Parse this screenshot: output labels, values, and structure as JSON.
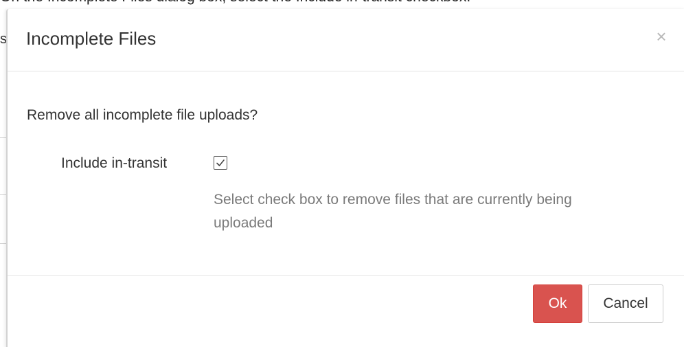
{
  "instruction": "On the Incomplete Files dialog box, select the Include in-transit checkbox.",
  "background": {
    "partial_char": "s"
  },
  "dialog": {
    "title": "Incomplete Files",
    "close_glyph": "×",
    "question": "Remove all incomplete file uploads?",
    "include_in_transit": {
      "label": "Include in-transit",
      "checked": true,
      "help": "Select check box to remove files that are currently being uploaded"
    },
    "buttons": {
      "ok_label": "Ok",
      "cancel_label": "Cancel"
    }
  },
  "colors": {
    "ok_button": "#d9534f",
    "help_text": "#7a7a7a"
  }
}
